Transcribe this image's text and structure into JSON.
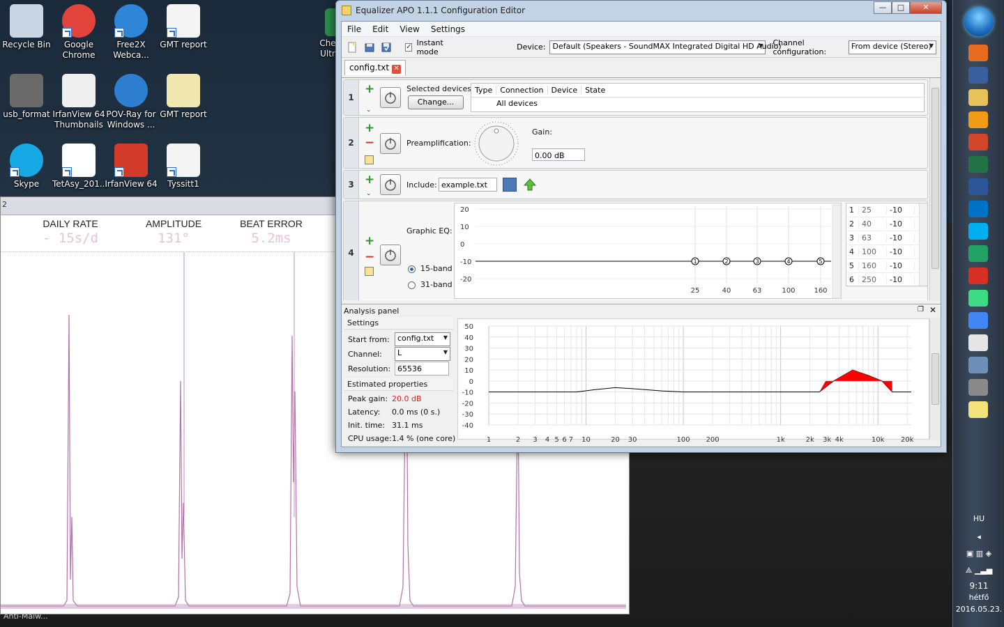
{
  "desktop": {
    "icons": [
      {
        "label": "Recycle Bin",
        "icon": "recycle-bin-icon"
      },
      {
        "label": "Google Chrome",
        "icon": "chrome-icon"
      },
      {
        "label": "Free2X Webca...",
        "icon": "webcam-icon"
      },
      {
        "label": "GMT report",
        "icon": "document-icon"
      },
      {
        "label": "usb_format",
        "icon": "usb-format-icon"
      },
      {
        "label": "IrfanView 64 Thumbnails",
        "icon": "irfanview-thumbnails-icon"
      },
      {
        "label": "POV-Ray for Windows ...",
        "icon": "povray-icon"
      },
      {
        "label": "GMT report",
        "icon": "spreadsheet-icon"
      },
      {
        "label": "Skype",
        "icon": "skype-icon"
      },
      {
        "label": "TetAsy_201...",
        "icon": "word-doc-icon"
      },
      {
        "label": "IrfanView 64",
        "icon": "irfanview-icon"
      },
      {
        "label": "Tyssitt1",
        "icon": "document-icon"
      }
    ],
    "partial_icon_label": "Che\nUltr"
  },
  "watch_app": {
    "title_fragment": "2",
    "metrics": [
      {
        "label": "DAILY RATE",
        "value": "- 15s/d"
      },
      {
        "label": "AMPLITUDE",
        "value": "131°"
      },
      {
        "label": "BEAT ERROR",
        "value": "5.2ms"
      }
    ],
    "bottom_text": "Anti-Malw..."
  },
  "eq_window": {
    "title": "Equalizer APO 1.1.1 Configuration Editor",
    "menu": [
      "File",
      "Edit",
      "View",
      "Settings"
    ],
    "toolbar": {
      "instant_mode_label": "Instant mode",
      "instant_mode_checked": true,
      "device_label": "Device:",
      "device_value": "Default (Speakers - SoundMAX Integrated Digital HD Audio)",
      "channel_config_label": "Channel configuration:",
      "channel_config_value": "From device (Stereo)"
    },
    "tab": {
      "label": "config.txt"
    },
    "panel1": {
      "num": "1",
      "selected_devices_label": "Selected devices:",
      "change_button": "Change...",
      "columns": [
        "Type",
        "Connection",
        "Device",
        "State"
      ],
      "row_value": "All devices"
    },
    "panel2": {
      "num": "2",
      "label": "Preamplification:",
      "gain_label": "Gain:",
      "gain_value": "0.00 dB"
    },
    "panel3": {
      "num": "3",
      "label": "Include:",
      "value": "example.txt"
    },
    "panel4": {
      "num": "4",
      "label": "Graphic EQ:",
      "option_15": "15-band",
      "option_31": "31-band",
      "selected_option": "15-band",
      "y_ticks": [
        "20",
        "10",
        "0",
        "-10",
        "-20"
      ],
      "x_ticks": [
        "25",
        "40",
        "63",
        "100",
        "160"
      ],
      "nodes": [
        "1",
        "2",
        "3",
        "4",
        "5"
      ],
      "table": [
        {
          "idx": "1",
          "freq": "25",
          "gain": "-10"
        },
        {
          "idx": "2",
          "freq": "40",
          "gain": "-10"
        },
        {
          "idx": "3",
          "freq": "63",
          "gain": "-10"
        },
        {
          "idx": "4",
          "freq": "100",
          "gain": "-10"
        },
        {
          "idx": "5",
          "freq": "160",
          "gain": "-10"
        },
        {
          "idx": "6",
          "freq": "250",
          "gain": "-10"
        }
      ]
    },
    "analysis": {
      "title": "Analysis panel",
      "settings_header": "Settings",
      "start_from_label": "Start from:",
      "start_from_value": "config.txt",
      "channel_label": "Channel:",
      "channel_value": "L",
      "resolution_label": "Resolution:",
      "resolution_value": "65536",
      "estimated_header": "Estimated properties",
      "peak_gain_label": "Peak gain:",
      "peak_gain_value": "20.0 dB",
      "latency_label": "Latency:",
      "latency_value": "0.0 ms (0 s.)",
      "init_time_label": "Init. time:",
      "init_time_value": "31.1 ms",
      "cpu_label": "CPU usage:",
      "cpu_value": "1.4 % (one core)",
      "y_ticks": [
        "50",
        "40",
        "30",
        "20",
        "10",
        "0",
        "-10",
        "-20",
        "-30",
        "-40"
      ],
      "x_ticks": [
        "1",
        "2",
        "3",
        "4",
        "5",
        "6",
        "7",
        "10",
        "20",
        "30",
        "100",
        "200",
        "1k",
        "2k",
        "3k",
        "4k",
        "10k",
        "20k"
      ],
      "peak_color": "#ff0000"
    }
  },
  "taskbar": {
    "language": "HU",
    "time": "9:11",
    "day": "hétfő",
    "date": "2016.05.23.",
    "apps": [
      "firefox-icon",
      "save-icon",
      "folder-icon",
      "media-player-icon",
      "powerpoint-icon",
      "excel-icon",
      "word-icon",
      "outlook-icon",
      "skype-icon",
      "app-icon",
      "gmail-icon",
      "android-icon",
      "chrome-icon",
      "grid-icon",
      "calculator-icon",
      "tools-icon",
      "notepad-icon"
    ]
  }
}
